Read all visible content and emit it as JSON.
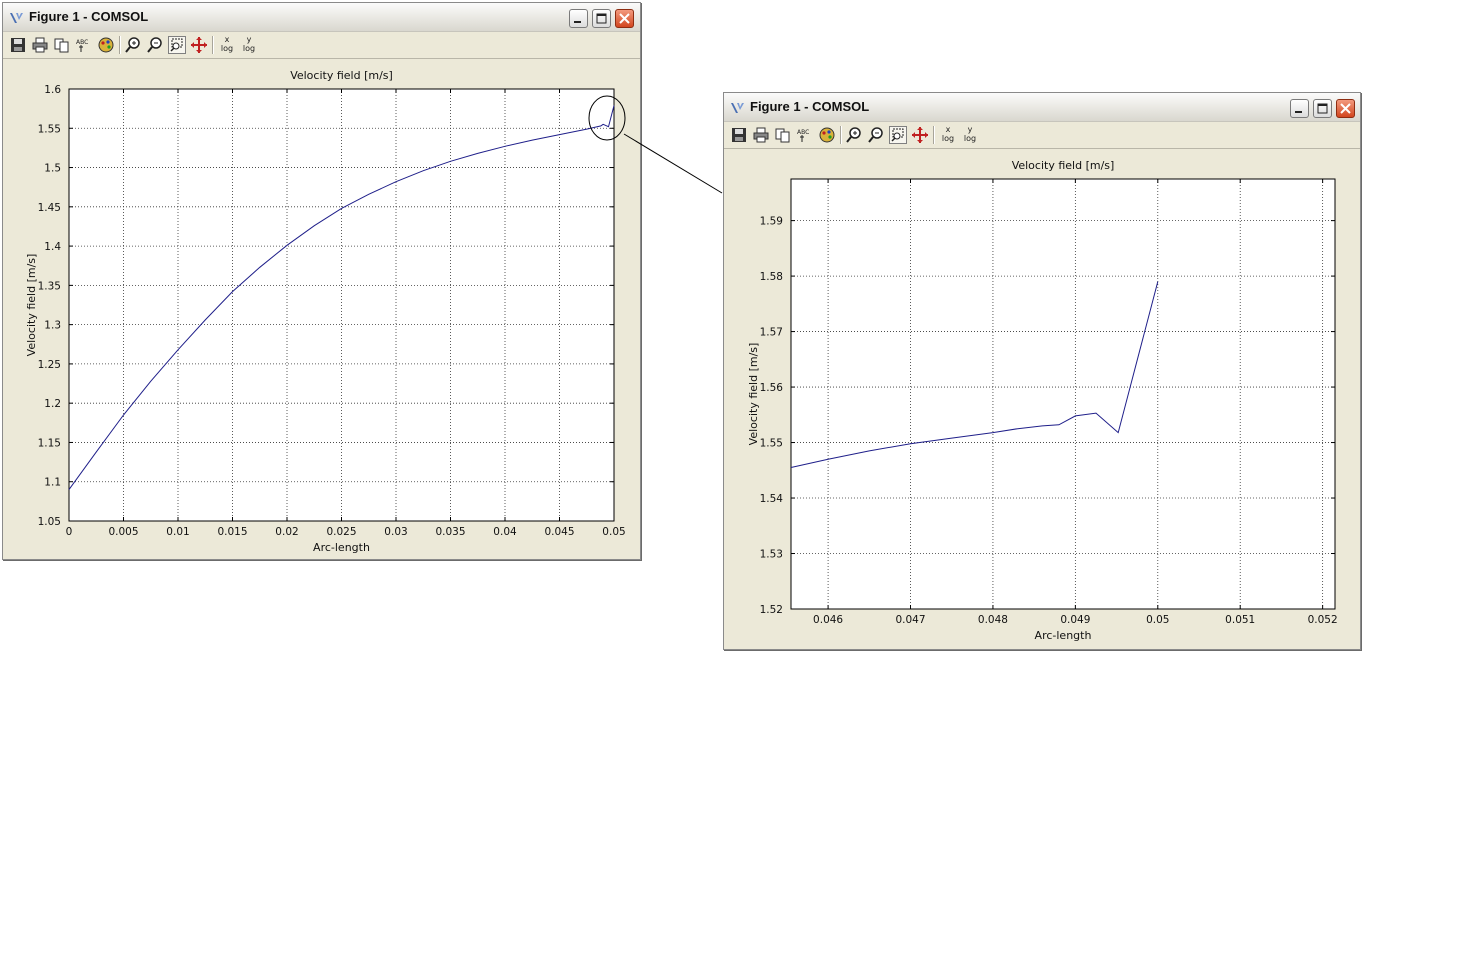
{
  "windows": [
    {
      "title": "Figure 1 - COMSOL",
      "toolbar": {
        "buttons": [
          "save-icon",
          "print-icon",
          "copy-icon",
          "abc-labels-icon",
          "colormap-icon",
          "zoom-in-icon",
          "zoom-out-icon",
          "zoom-box-icon",
          "pan-icon"
        ],
        "x_log_axis": "x",
        "y_log_axis": "y",
        "log_label": "log"
      }
    },
    {
      "title": "Figure 1 - COMSOL",
      "toolbar": {
        "buttons": [
          "save-icon",
          "print-icon",
          "copy-icon",
          "abc-labels-icon",
          "colormap-icon",
          "zoom-in-icon",
          "zoom-out-icon",
          "zoom-box-icon",
          "pan-icon"
        ],
        "x_log_axis": "x",
        "y_log_axis": "y",
        "log_label": "log"
      }
    }
  ],
  "chart_data": [
    {
      "type": "line",
      "title": "Velocity field [m/s]",
      "xlabel": "Arc-length",
      "ylabel": "Velocity field [m/s]",
      "xlim": [
        0,
        0.05
      ],
      "ylim": [
        1.05,
        1.6
      ],
      "xticks": [
        "0",
        "0.005",
        "0.01",
        "0.015",
        "0.02",
        "0.025",
        "0.03",
        "0.035",
        "0.04",
        "0.045",
        "0.05"
      ],
      "xtick_values": [
        0,
        0.005,
        0.01,
        0.015,
        0.02,
        0.025,
        0.03,
        0.035,
        0.04,
        0.045,
        0.05
      ],
      "yticks": [
        "1.05",
        "1.1",
        "1.15",
        "1.2",
        "1.25",
        "1.3",
        "1.35",
        "1.4",
        "1.45",
        "1.5",
        "1.55",
        "1.6"
      ],
      "ytick_values": [
        1.05,
        1.1,
        1.15,
        1.2,
        1.25,
        1.3,
        1.35,
        1.4,
        1.45,
        1.5,
        1.55,
        1.6
      ],
      "grid": true,
      "line_color": "#1f1f8a",
      "series": [
        {
          "x": [
            0,
            0.0025,
            0.005,
            0.0075,
            0.01,
            0.0125,
            0.015,
            0.0175,
            0.02,
            0.0225,
            0.025,
            0.0275,
            0.03,
            0.0325,
            0.035,
            0.0375,
            0.04,
            0.0425,
            0.045,
            0.0475,
            0.0488,
            0.049,
            0.0495,
            0.05
          ],
          "y": [
            1.09,
            1.138,
            1.185,
            1.228,
            1.268,
            1.306,
            1.342,
            1.373,
            1.401,
            1.426,
            1.448,
            1.466,
            1.482,
            1.496,
            1.508,
            1.518,
            1.527,
            1.535,
            1.542,
            1.549,
            1.553,
            1.555,
            1.552,
            1.579
          ]
        }
      ]
    },
    {
      "type": "line",
      "title": "Velocity field [m/s]",
      "xlabel": "Arc-length",
      "ylabel": "Velocity field [m/s]",
      "xlim": [
        0.04555,
        0.05215
      ],
      "ylim": [
        1.52,
        1.5975
      ],
      "xticks": [
        "0.046",
        "0.047",
        "0.048",
        "0.049",
        "0.05",
        "0.051",
        "0.052"
      ],
      "xtick_values": [
        0.046,
        0.047,
        0.048,
        0.049,
        0.05,
        0.051,
        0.052
      ],
      "yticks": [
        "1.52",
        "1.53",
        "1.54",
        "1.55",
        "1.56",
        "1.57",
        "1.58",
        "1.59"
      ],
      "ytick_values": [
        1.52,
        1.53,
        1.54,
        1.55,
        1.56,
        1.57,
        1.58,
        1.59
      ],
      "grid": true,
      "line_color": "#1f1f8a",
      "series": [
        {
          "x": [
            0.04555,
            0.046,
            0.0465,
            0.047,
            0.0475,
            0.048,
            0.0483,
            0.0486,
            0.0488,
            0.049,
            0.04925,
            0.04952,
            0.05
          ],
          "y": [
            1.5455,
            1.547,
            1.5485,
            1.5498,
            1.5508,
            1.5518,
            1.5525,
            1.553,
            1.5532,
            1.5548,
            1.5553,
            1.5518,
            1.579
          ]
        }
      ]
    }
  ]
}
